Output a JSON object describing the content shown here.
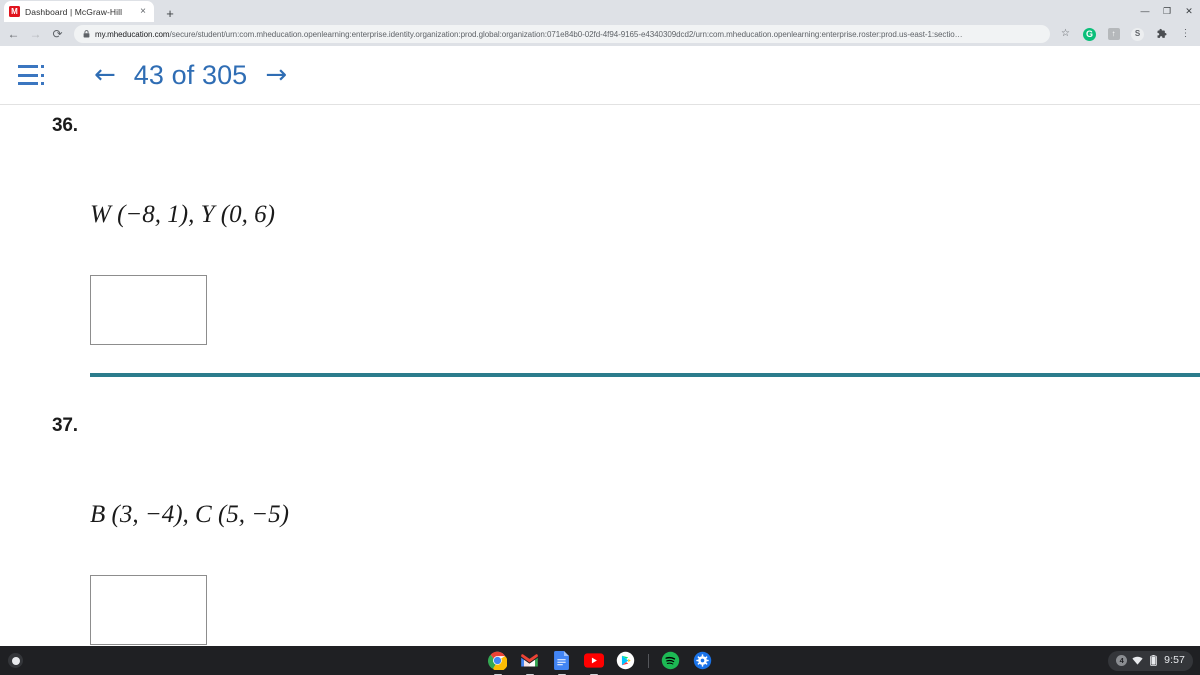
{
  "browser": {
    "tab": {
      "favicon_letter": "M",
      "favicon_name": "mcgraw-hill-favicon",
      "title": "Dashboard | McGraw-Hill",
      "close_glyph": "×"
    },
    "new_tab_glyph": "+",
    "window_controls": {
      "minimize": "—",
      "maximize": "❐",
      "close": "✕"
    },
    "nav": {
      "back_glyph": "←",
      "forward_glyph": "→",
      "reload_glyph": "⟳"
    },
    "omnibox": {
      "lock_glyph": "🔒",
      "host": "my.mheducation.com",
      "path": "/secure/student/urn:com.mheducation.openlearning:enterprise.identity.organization:prod.global:organization:071e84b0-02fd-4f94-9165-e4340309dcd2/urn:com.mheducation.openlearning:enterprise.roster:prod.us-east-1:sectio…"
    },
    "toolbar": {
      "bookmark_glyph": "☆",
      "ext_green_label": "G",
      "ext_gray_label": "↑",
      "ext_s_label": "S",
      "extensions_glyph": "❖",
      "menu_glyph": "⋮"
    }
  },
  "app_header": {
    "menu_icon_name": "list-menu-icon",
    "prev_glyph": "←",
    "next_glyph": "→",
    "page_label": "43 of 305",
    "accent_color": "#2f6db4"
  },
  "content": {
    "divider_color": "#2b7c8c",
    "problems": [
      {
        "number": "36.",
        "expression": "W (−8, 1), Y (0, 6)",
        "answer_value": "",
        "has_divider": true
      },
      {
        "number": "37.",
        "expression": "B (3, −4), C (5, −5)",
        "answer_value": "",
        "has_divider": false
      }
    ]
  },
  "shelf": {
    "launcher_name": "launcher-button",
    "apps": [
      {
        "name": "chrome",
        "label": "Chrome"
      },
      {
        "name": "gmail",
        "label": "Gmail"
      },
      {
        "name": "google-docs",
        "label": "Docs"
      },
      {
        "name": "youtube",
        "label": "YouTube"
      },
      {
        "name": "google-play",
        "label": "Play Store"
      },
      {
        "name": "spotify",
        "label": "Spotify"
      },
      {
        "name": "settings",
        "label": "Settings"
      }
    ],
    "tray": {
      "badge": "4",
      "wifi_name": "wifi-icon",
      "battery_name": "battery-icon",
      "time": "9:57"
    }
  }
}
